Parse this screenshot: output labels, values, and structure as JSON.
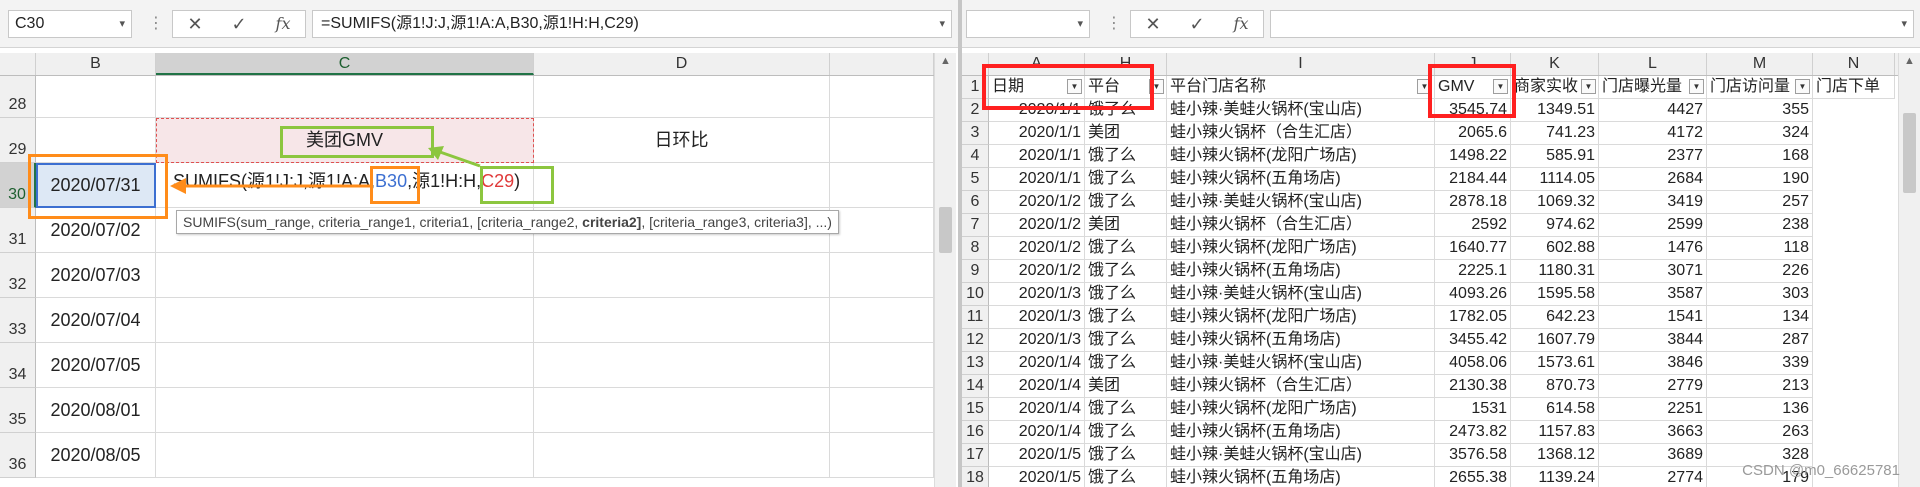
{
  "left": {
    "name_box": "C30",
    "formula": "=SUMIFS(源1!J:J,源1!A:A,B30,源1!H:H,C29)",
    "columns": [
      "B",
      "C",
      "D"
    ],
    "rows": [
      {
        "num": "28",
        "b": "",
        "c": "",
        "d": ""
      },
      {
        "num": "29",
        "b": "",
        "c": "美团GMV",
        "d": "日环比"
      },
      {
        "num": "30",
        "b": "2020/07/31",
        "c": "",
        "d": ""
      },
      {
        "num": "31",
        "b": "2020/07/02",
        "c": "",
        "d": ""
      },
      {
        "num": "32",
        "b": "2020/07/03",
        "c": "",
        "d": ""
      },
      {
        "num": "33",
        "b": "2020/07/04",
        "c": "",
        "d": ""
      },
      {
        "num": "34",
        "b": "2020/07/05",
        "c": "",
        "d": ""
      },
      {
        "num": "35",
        "b": "2020/08/01",
        "c": "",
        "d": ""
      },
      {
        "num": "36",
        "b": "2020/08/05",
        "c": "",
        "d": ""
      }
    ],
    "edit": {
      "part1": "SUMIFS(源1!J:J,源1!A:A,",
      "ref1": "B30",
      "part2": ",源1!H:H,",
      "ref2": "C29",
      "part3": ")"
    },
    "tooltip": {
      "pre": "SUMIFS(sum_range, criteria_range1, criteria1, [criteria_range2, ",
      "bold": "criteria2]",
      "post": ", [criteria_range3, criteria3], ...)"
    }
  },
  "right": {
    "name_box": "",
    "formula": "",
    "columns": [
      "A",
      "H",
      "I",
      "J",
      "K",
      "L",
      "M",
      "N"
    ],
    "headers": [
      "日期",
      "平台",
      "平台门店名称",
      "GMV",
      "商家实收",
      "门店曝光量",
      "门店访问量",
      "门店下单"
    ],
    "rows": [
      [
        "2",
        "2020/1/1",
        "饿了么",
        "蛙小辣·美蛙火锅杯(宝山店)",
        "3545.74",
        "1349.51",
        "4427",
        "355"
      ],
      [
        "3",
        "2020/1/1",
        "美团",
        "蛙小辣火锅杯（合生汇店）",
        "2065.6",
        "741.23",
        "4172",
        "324"
      ],
      [
        "4",
        "2020/1/1",
        "饿了么",
        "蛙小辣火锅杯(龙阳广场店)",
        "1498.22",
        "585.91",
        "2377",
        "168"
      ],
      [
        "5",
        "2020/1/1",
        "饿了么",
        "蛙小辣火锅杯(五角场店)",
        "2184.44",
        "1114.05",
        "2684",
        "190"
      ],
      [
        "6",
        "2020/1/2",
        "饿了么",
        "蛙小辣·美蛙火锅杯(宝山店)",
        "2878.18",
        "1069.32",
        "3419",
        "257"
      ],
      [
        "7",
        "2020/1/2",
        "美团",
        "蛙小辣火锅杯（合生汇店）",
        "2592",
        "974.62",
        "2599",
        "238"
      ],
      [
        "8",
        "2020/1/2",
        "饿了么",
        "蛙小辣火锅杯(龙阳广场店)",
        "1640.77",
        "602.88",
        "1476",
        "118"
      ],
      [
        "9",
        "2020/1/2",
        "饿了么",
        "蛙小辣火锅杯(五角场店)",
        "2225.1",
        "1180.31",
        "3071",
        "226"
      ],
      [
        "10",
        "2020/1/3",
        "饿了么",
        "蛙小辣·美蛙火锅杯(宝山店)",
        "4093.26",
        "1595.58",
        "3587",
        "303"
      ],
      [
        "11",
        "2020/1/3",
        "饿了么",
        "蛙小辣火锅杯(龙阳广场店)",
        "1782.05",
        "642.23",
        "1541",
        "134"
      ],
      [
        "12",
        "2020/1/3",
        "饿了么",
        "蛙小辣火锅杯(五角场店)",
        "3455.42",
        "1607.79",
        "3844",
        "287"
      ],
      [
        "13",
        "2020/1/4",
        "饿了么",
        "蛙小辣·美蛙火锅杯(宝山店)",
        "4058.06",
        "1573.61",
        "3846",
        "339"
      ],
      [
        "14",
        "2020/1/4",
        "美团",
        "蛙小辣火锅杯（合生汇店）",
        "2130.38",
        "870.73",
        "2779",
        "213"
      ],
      [
        "15",
        "2020/1/4",
        "饿了么",
        "蛙小辣火锅杯(龙阳广场店)",
        "1531",
        "614.58",
        "2251",
        "136"
      ],
      [
        "16",
        "2020/1/4",
        "饿了么",
        "蛙小辣火锅杯(五角场店)",
        "2473.82",
        "1157.83",
        "3663",
        "263"
      ],
      [
        "17",
        "2020/1/5",
        "饿了么",
        "蛙小辣·美蛙火锅杯(宝山店)",
        "3576.58",
        "1368.12",
        "3689",
        "328"
      ],
      [
        "18",
        "2020/1/5",
        "饿了么",
        "蛙小辣火锅杯(五角场店)",
        "2655.38",
        "1139.24",
        "2774",
        "179"
      ]
    ],
    "watermark": "CSDN @m0_66625781"
  },
  "icons": {
    "cancel": "✕",
    "confirm": "✓",
    "function": "fx",
    "dropdown": "▾",
    "filter": "▼",
    "scroll_up": "▲",
    "dots": "⋮"
  },
  "colors": {
    "annotation_orange": "#ff8c1a",
    "annotation_green": "#8cc63f",
    "annotation_red": "#ff2020",
    "ref_blue": "#3c6fd1",
    "ref_red": "#e03a3a",
    "header_fill": "#f7e6e8",
    "selection_green": "#217346"
  }
}
